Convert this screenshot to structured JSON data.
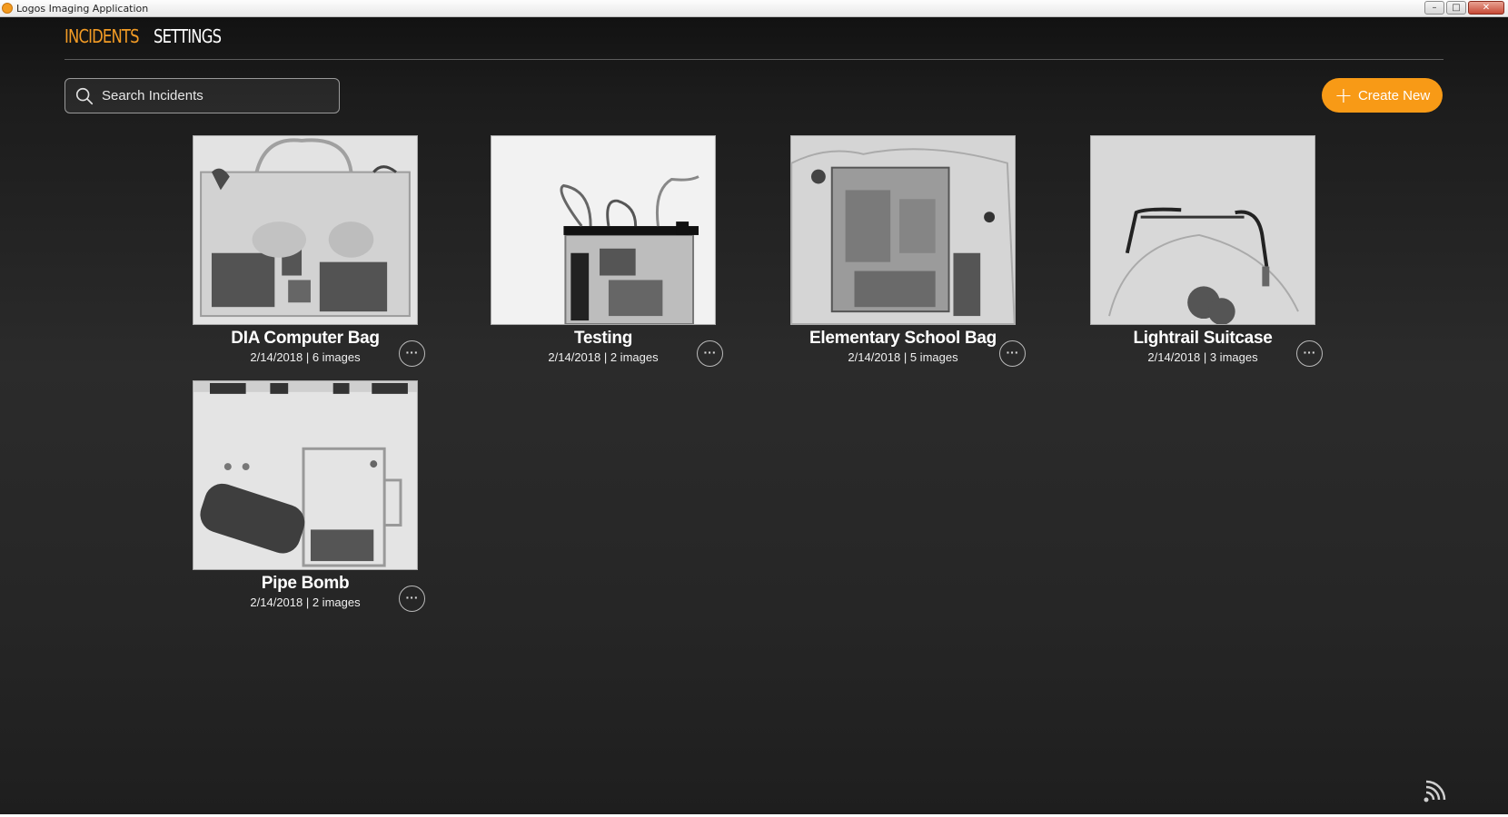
{
  "window": {
    "title": "Logos Imaging Application",
    "min": "–",
    "max": "□",
    "close": "✕"
  },
  "nav": {
    "tabs": [
      {
        "label": "INCIDENTS"
      },
      {
        "label": "SETTINGS"
      }
    ]
  },
  "search": {
    "placeholder": "Search Incidents",
    "value": ""
  },
  "create_button": {
    "label": "Create New"
  },
  "colors": {
    "accent": "#f29b25",
    "button": "#f89a16"
  },
  "incidents": [
    {
      "title": "DIA Computer Bag",
      "meta": "2/14/2018 | 6 images",
      "more": "···"
    },
    {
      "title": "Testing",
      "meta": "2/14/2018 | 2 images",
      "more": "···"
    },
    {
      "title": "Elementary School Bag",
      "meta": "2/14/2018 | 5 images",
      "more": "···"
    },
    {
      "title": "Lightrail Suitcase",
      "meta": "2/14/2018 | 3 images",
      "more": "···"
    },
    {
      "title": "Pipe Bomb",
      "meta": "2/14/2018 | 2 images",
      "more": "···"
    }
  ]
}
